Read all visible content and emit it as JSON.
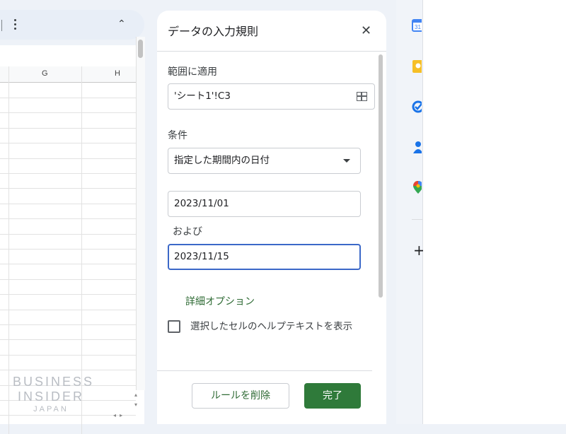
{
  "toolbar": {
    "more_icon": "more-vert-icon",
    "collapse_icon": "chevron-up-icon"
  },
  "sheet": {
    "columns": [
      "G",
      "H"
    ]
  },
  "watermark": {
    "line1": "BUSINESS",
    "line2": "INSIDER",
    "line3": "JAPAN"
  },
  "panel": {
    "title": "データの入力規則",
    "close_icon": "close-icon",
    "range_label": "範囲に適用",
    "range_value": "'シート1'!C3",
    "range_icon": "grid-select-icon",
    "criteria_label": "条件",
    "criteria_value": "指定した期間内の日付",
    "date_from": "2023/11/01",
    "and_label": "および",
    "date_to": "2023/11/15",
    "advanced_options": "詳細オプション",
    "help_text_checkbox": {
      "label": "選択したセルのヘルプテキストを表示",
      "checked": false
    },
    "delete_rule_button": "ルールを削除",
    "done_button": "完了"
  },
  "sidebar": {
    "icons": [
      "google-calendar-icon",
      "google-keep-icon",
      "google-tasks-icon",
      "google-contacts-icon",
      "google-maps-icon"
    ],
    "add_icon": "plus-icon"
  },
  "colors": {
    "accent_green": "#2f7a3a",
    "link_green": "#2f6b35",
    "focus_blue": "#3b68c8"
  }
}
